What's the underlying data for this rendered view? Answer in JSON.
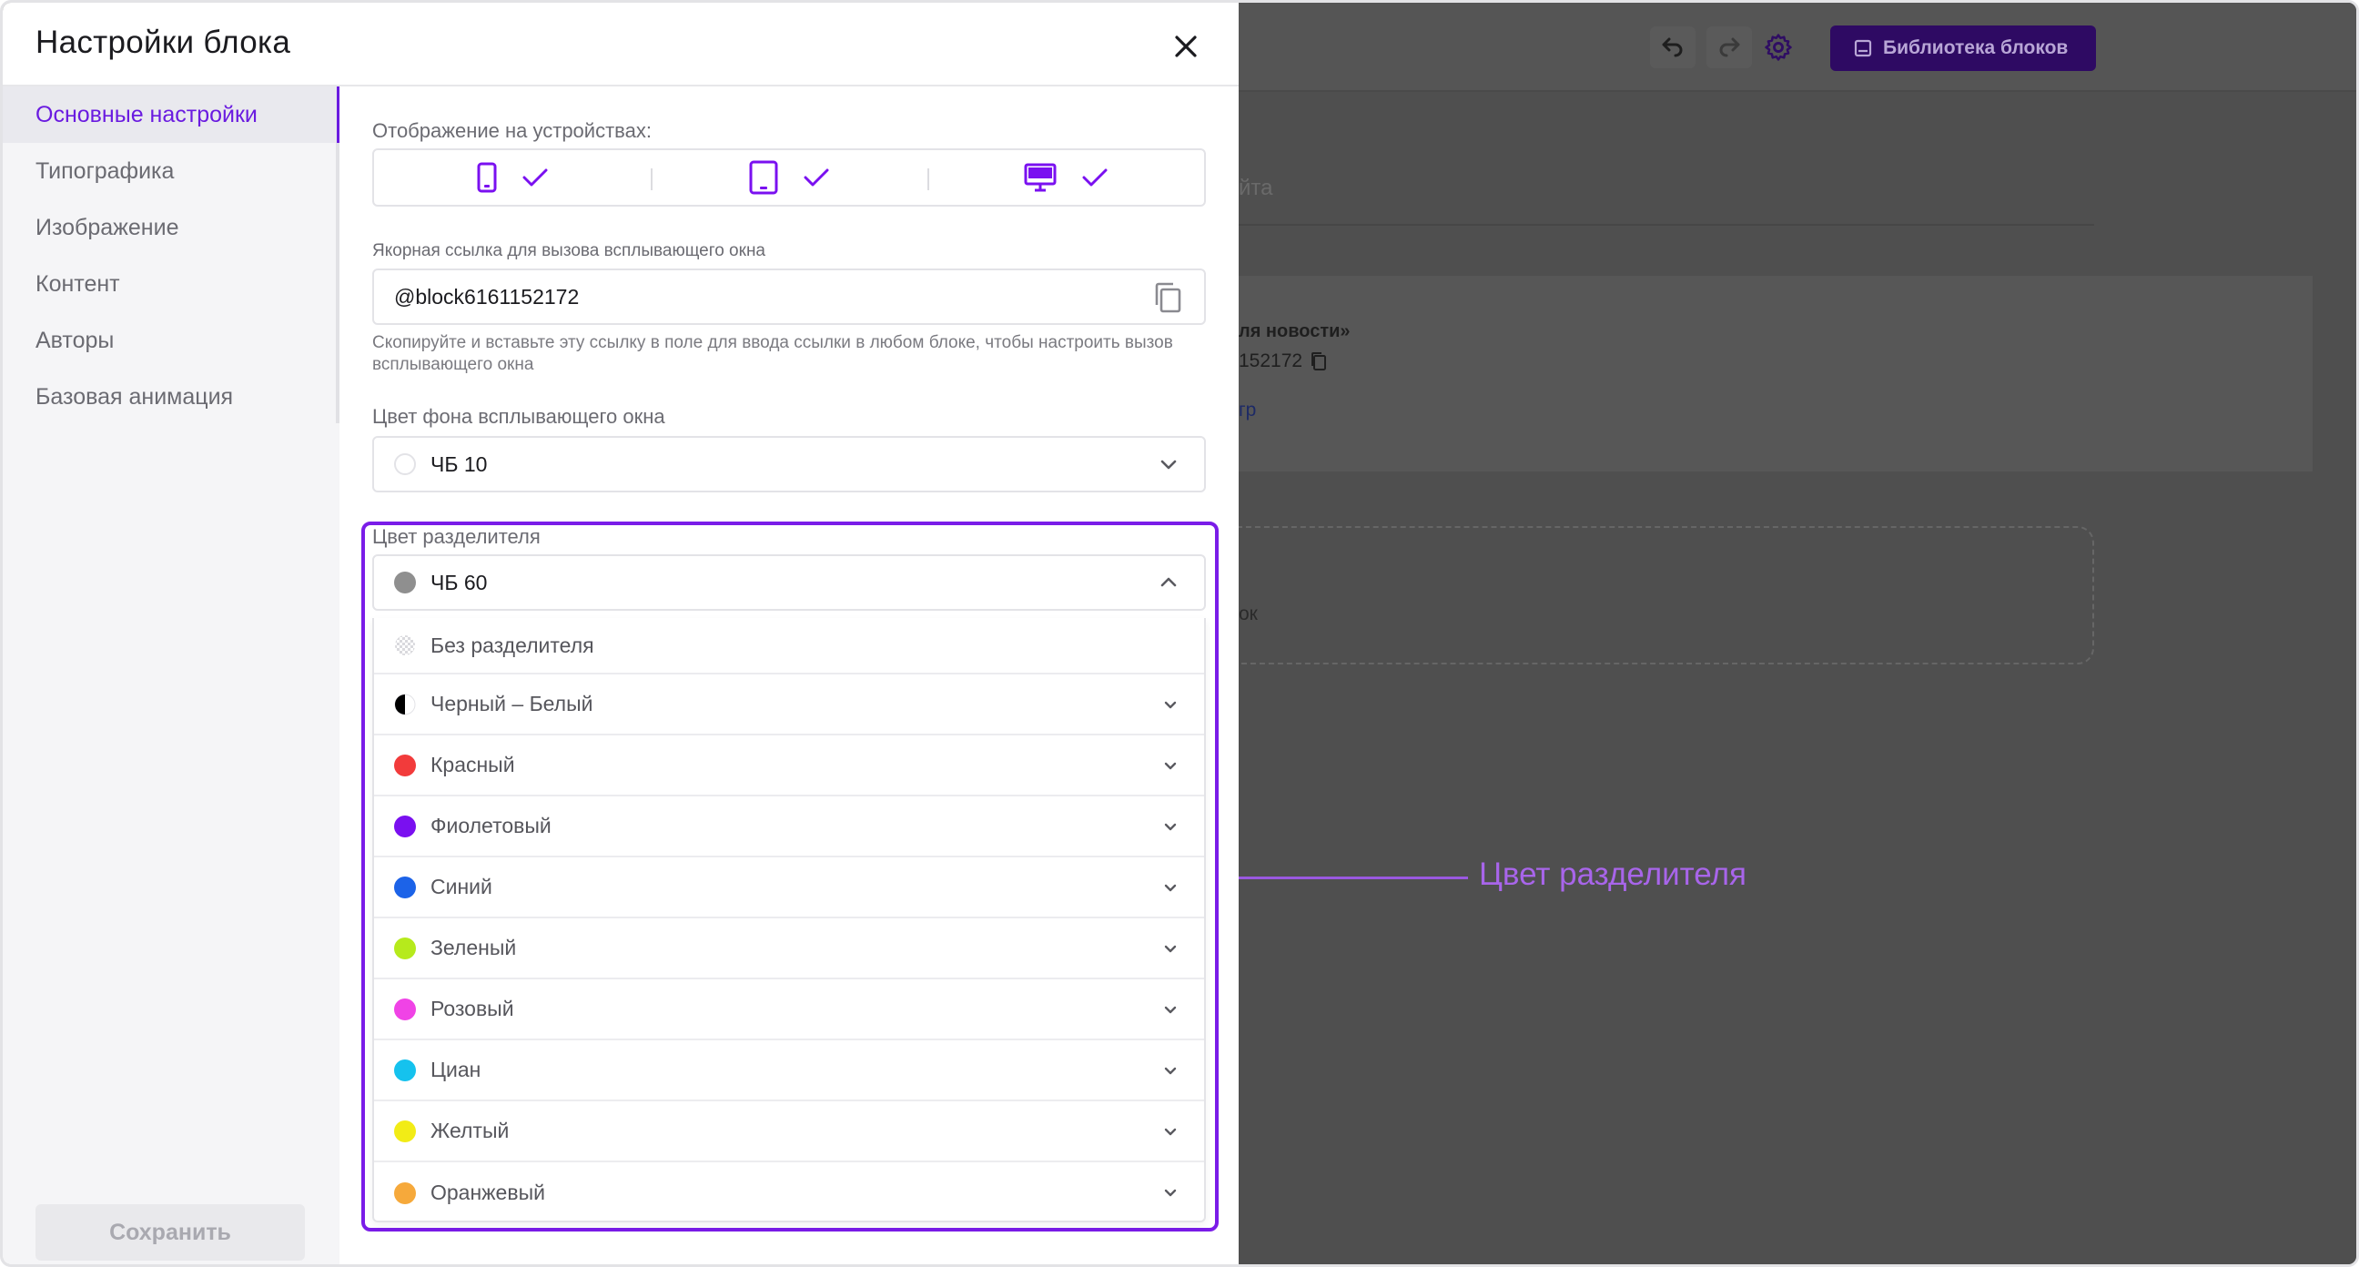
{
  "modal": {
    "title": "Настройки блока",
    "close_label": "close"
  },
  "sidebar": {
    "items": [
      {
        "label": "Основные настройки",
        "active": true
      },
      {
        "label": "Типографика",
        "active": false
      },
      {
        "label": "Изображение",
        "active": false
      },
      {
        "label": "Контент",
        "active": false
      },
      {
        "label": "Авторы",
        "active": false
      },
      {
        "label": "Базовая анимация",
        "active": false
      }
    ],
    "save_label": "Сохранить"
  },
  "content": {
    "devices_label": "Отображение на устройствах:",
    "devices": [
      {
        "icon": "mobile-icon",
        "checked": true
      },
      {
        "icon": "tablet-icon",
        "checked": true
      },
      {
        "icon": "desktop-icon",
        "checked": true
      }
    ],
    "anchor_label": "Якорная ссылка для вызова всплывающего окна",
    "anchor_value": "@block6161152172",
    "anchor_hint": "Скопируйте и вставьте эту ссылку в поле для ввода ссылки в любом блоке, чтобы настроить вызов всплывающего окна",
    "bg_color_label": "Цвет фона всплывающего окна",
    "bg_color_value": "ЧБ 10",
    "divider_label": "Цвет разделителя",
    "divider_value": "ЧБ 60",
    "divider_options": [
      {
        "label": "Без разделителя",
        "color": "pattern",
        "expandable": false
      },
      {
        "label": "Черный – Белый",
        "color": "half",
        "expandable": true
      },
      {
        "label": "Красный",
        "color": "#f23b3b",
        "expandable": true
      },
      {
        "label": "Фиолетовый",
        "color": "#7a10f0",
        "expandable": true
      },
      {
        "label": "Синий",
        "color": "#1c63e8",
        "expandable": true
      },
      {
        "label": "Зеленый",
        "color": "#b6ea1c",
        "expandable": true
      },
      {
        "label": "Розовый",
        "color": "#f043e6",
        "expandable": true
      },
      {
        "label": "Циан",
        "color": "#15c2ee",
        "expandable": true
      },
      {
        "label": "Желтый",
        "color": "#f2ec16",
        "expandable": true
      },
      {
        "label": "Оранжевый",
        "color": "#f6a93b",
        "expandable": true
      }
    ]
  },
  "background": {
    "library_button": "Библиотека блоков",
    "input_fragment": "йта",
    "card_title_fragment": "ля новости»",
    "card_id_fragment": "152172",
    "card_link_fragment": "гр",
    "dashed_fragment": "ок"
  },
  "annotation": {
    "label": "Цвет разделителя"
  },
  "colors": {
    "accent": "#6a1be0",
    "highlight": "#7a1ce8",
    "annotation": "#a865ea",
    "chb10": "#ffffff",
    "chb60": "#8f8f8f"
  }
}
